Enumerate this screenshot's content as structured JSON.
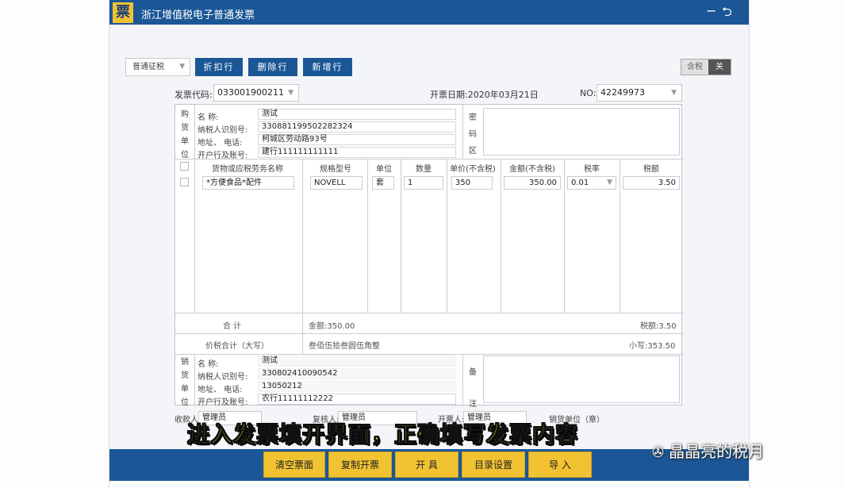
{
  "window": {
    "title": "浙江增值税电子普通发票",
    "logo_text": "票",
    "minimize_icon": "−",
    "back_icon": "⮌"
  },
  "toolbar": {
    "tax_type": "普通征税",
    "discount_row": "折扣行",
    "delete_row": "删除行",
    "new_row": "新增行",
    "tax_inclusive": "含税",
    "tax_toggle_off": "关"
  },
  "meta": {
    "code_label": "发票代码:",
    "code_value": "033001900211",
    "date_label": "开票日期:2020年03月21日",
    "no_label": "NO:",
    "no_value": "42249973"
  },
  "buyer": {
    "side_label": [
      "购",
      "货",
      "单",
      "位"
    ],
    "name_label": "名        称:",
    "name_value": "测试",
    "taxid_label": "纳税人识别号:",
    "taxid_value": "330881199502282324",
    "addr_label": "地址、  电话:",
    "addr_value": "柯城区劳动路93号",
    "bank_label": "开户行及账号:",
    "bank_value": "建行111111111111",
    "secret_label": [
      "密",
      "码",
      "区"
    ]
  },
  "items": {
    "headers": [
      "货物或应税劳务名称",
      "规格型号",
      "单位",
      "数量",
      "单价(不含税)",
      "金额(不含税)",
      "税率",
      "税额"
    ],
    "rows": [
      {
        "name": "*方便食品*配件",
        "spec": "NOVELL",
        "unit": "套",
        "qty": "1",
        "price": "350",
        "amount": "350.00",
        "rate": "0.01",
        "tax": "3.50"
      }
    ]
  },
  "totals": {
    "sum_label": "合      计",
    "amount": "金额:350.00",
    "tax": "税额:3.50",
    "total_label": "价税合计（大写）",
    "total_words": "叁佰伍拾叁圆伍角整",
    "total_small": "小写:353.50"
  },
  "seller": {
    "side_label": [
      "销",
      "货",
      "单",
      "位"
    ],
    "name_label": "名        称:",
    "name_value": "测试",
    "taxid_label": "纳税人识别号:",
    "taxid_value": "330802410090542",
    "addr_label": "地址、  电话:",
    "addr_value": "13050212",
    "bank_label": "开户行及账号:",
    "bank_value": "农行11111112222",
    "remark_label": [
      "备",
      "注"
    ]
  },
  "signoff": {
    "receiver_label": "收款人:",
    "receiver_value": "管理员",
    "reviewer_label": "复核人:",
    "reviewer_value": "管理员",
    "issuer_label": "开票人:",
    "issuer_value": "管理员",
    "seller_label": "销货单位（章）"
  },
  "actions": [
    "清空票面",
    "复制开票",
    "开 具",
    "目录设置",
    "导 入"
  ],
  "overlay": {
    "caption": "进入发票填开界面，正确填写发票内容",
    "watermark": "晶晶亮的税月"
  },
  "colors": {
    "titlebar": "#1b5797",
    "button_yellow": "#f1c232",
    "caption": "#ffe100"
  }
}
